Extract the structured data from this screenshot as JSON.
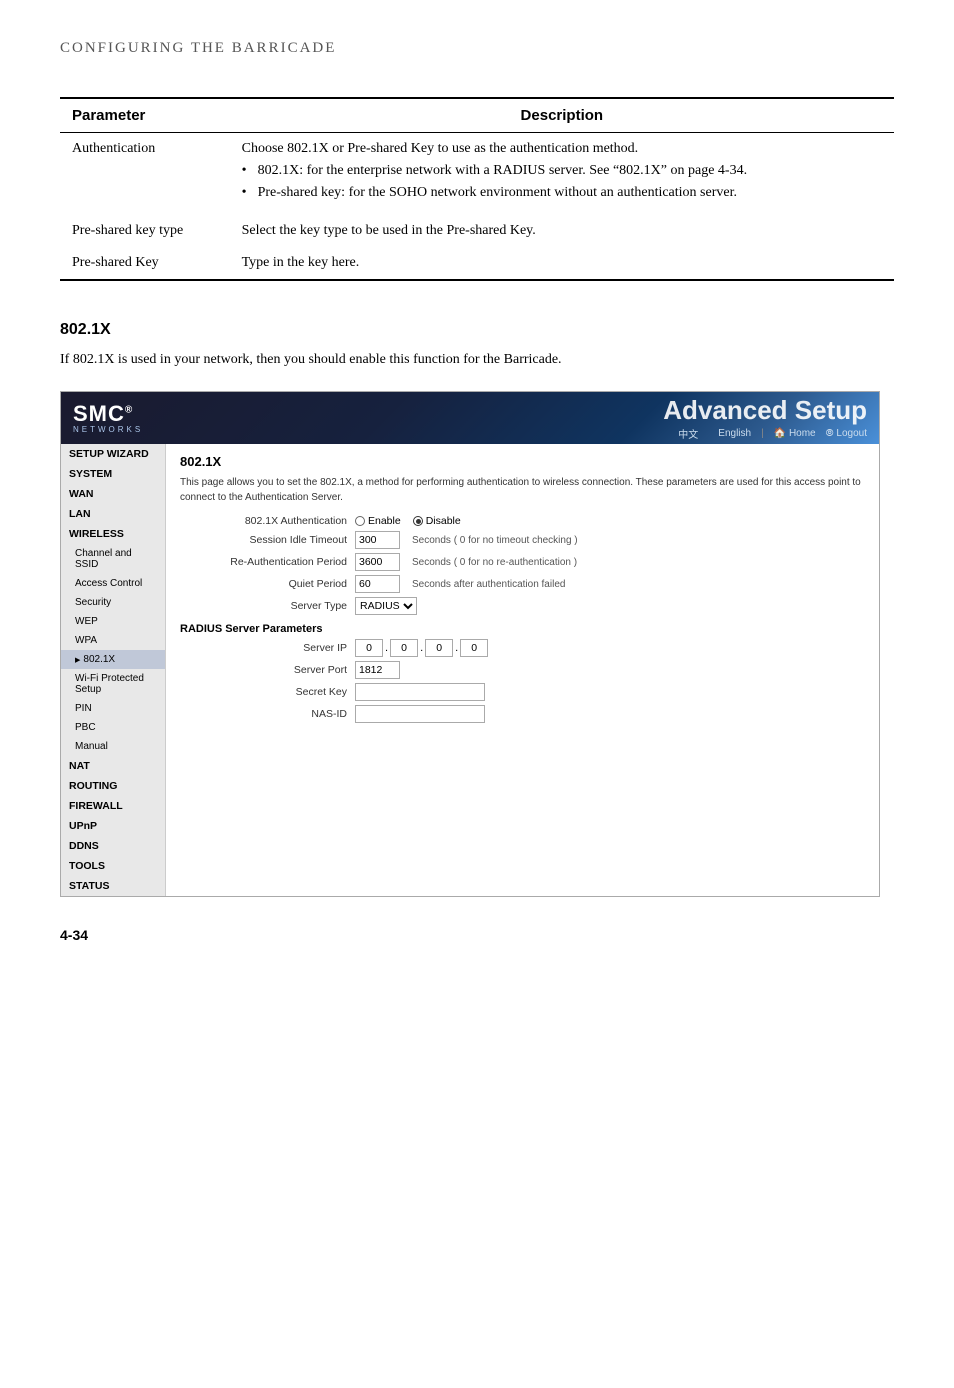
{
  "header": {
    "title": "Configuring the Barricade"
  },
  "table": {
    "col1": "Parameter",
    "col2": "Description",
    "rows": [
      {
        "param": "Authentication",
        "desc_main": "Choose 802.1X or Pre-shared Key to use as the authentication method.",
        "bullets": [
          "802.1X: for the enterprise network with a RADIUS server. See “802.1X” on page 4-34.",
          "Pre-shared key: for the SOHO network environment without an authentication server."
        ]
      },
      {
        "param": "Pre-shared key type",
        "desc_main": "Select the key type to be used in the Pre-shared Key.",
        "bullets": []
      },
      {
        "param": "Pre-shared Key",
        "desc_main": "Type in the key here.",
        "bullets": []
      }
    ]
  },
  "section_802": {
    "heading": "802.1X",
    "text": "If 802.1X is used in your network, then you should enable this function for the Barricade."
  },
  "router_ui": {
    "logo": "SMC",
    "logo_reg": "®",
    "networks": "Networks",
    "advanced_title": "Advanced Setup",
    "lang_zh": "中文",
    "lang_en": "English",
    "nav_home": "🏠 Home",
    "nav_logout": "⦾ Logout",
    "sidebar": [
      {
        "label": "SETUP WIZARD",
        "bold": true
      },
      {
        "label": "SYSTEM",
        "bold": true
      },
      {
        "label": "WAN",
        "bold": true
      },
      {
        "label": "LAN",
        "bold": true
      },
      {
        "label": "WIRELESS",
        "bold": true
      },
      {
        "label": "Channel and SSID",
        "sub": true
      },
      {
        "label": "Access Control",
        "sub": true
      },
      {
        "label": "Security",
        "sub": true
      },
      {
        "label": "WEP",
        "sub": true
      },
      {
        "label": "WPA",
        "sub": true
      },
      {
        "label": "802.1X",
        "sub": true,
        "active": true
      },
      {
        "label": "Wi-Fi Protected Setup",
        "sub": true
      },
      {
        "label": "PIN",
        "sub": true
      },
      {
        "label": "PBC",
        "sub": true
      },
      {
        "label": "Manual",
        "sub": true
      },
      {
        "label": "NAT",
        "bold": true
      },
      {
        "label": "ROUTING",
        "bold": true
      },
      {
        "label": "FIREWALL",
        "bold": true
      },
      {
        "label": "UPnP",
        "bold": true
      },
      {
        "label": "DDNS",
        "bold": true
      },
      {
        "label": "TOOLS",
        "bold": true
      },
      {
        "label": "STATUS",
        "bold": true
      }
    ],
    "content": {
      "title": "802.1X",
      "desc": "This page allows you to set the 802.1X, a method for performing authentication to wireless connection. These parameters are used for this access point to connect to the Authentication Server.",
      "fields": {
        "auth_label": "802.1X Authentication",
        "auth_enable": "Enable",
        "auth_disable": "Disable",
        "auth_selected": "Disable",
        "session_label": "Session Idle Timeout",
        "session_value": "300",
        "session_hint": "Seconds ( 0 for no timeout checking )",
        "reauth_label": "Re-Authentication Period",
        "reauth_value": "3600",
        "reauth_hint": "Seconds ( 0 for no re-authentication )",
        "quiet_label": "Quiet Period",
        "quiet_value": "60",
        "quiet_hint": "Seconds after authentication failed",
        "server_type_label": "Server Type",
        "server_type_value": "RADIUS",
        "radius_section": "RADIUS Server Parameters",
        "server_ip_label": "Server IP",
        "server_ip": [
          "0",
          "0",
          "0",
          "0"
        ],
        "server_port_label": "Server Port",
        "server_port_value": "1812",
        "secret_key_label": "Secret Key",
        "nas_id_label": "NAS-ID"
      }
    }
  },
  "page_number": "4-34"
}
